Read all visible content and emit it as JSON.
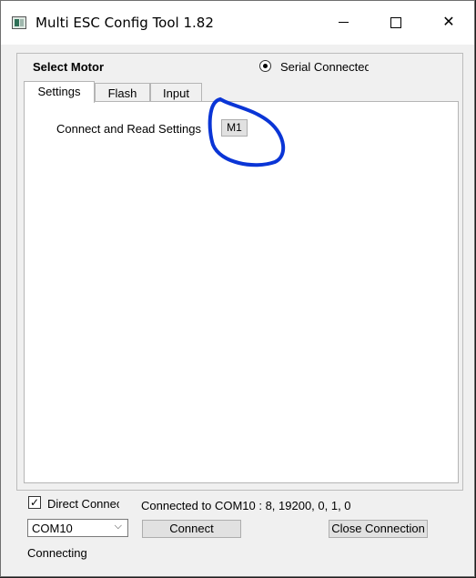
{
  "window": {
    "title": "Multi ESC Config Tool 1.82",
    "minimize_icon": "minimize-icon",
    "maximize_icon": "maximize-icon",
    "close_glyph": "✕"
  },
  "motor_group": {
    "label": "Select Motor",
    "radio_label": "Serial Connected",
    "radio_selected": true
  },
  "tabs": [
    {
      "label": "Settings",
      "active": true
    },
    {
      "label": "Flash",
      "active": false
    },
    {
      "label": "Input",
      "active": false
    }
  ],
  "settings_panel": {
    "connect_read_label": "Connect and Read Settings",
    "motor_button": "M1"
  },
  "annotation": {
    "color": "#0a35d6"
  },
  "bottom": {
    "direct_connect_label": "Direct Connect",
    "direct_connect_checked": true,
    "check_glyph": "✓",
    "connection_info": "Connected to COM10 : 8, 19200, 0, 1, 0",
    "port_select": {
      "value": "COM10",
      "chevron": "⌵"
    },
    "connect_button": "Connect",
    "close_connection_button": "Close Connection",
    "status": "Connecting"
  }
}
